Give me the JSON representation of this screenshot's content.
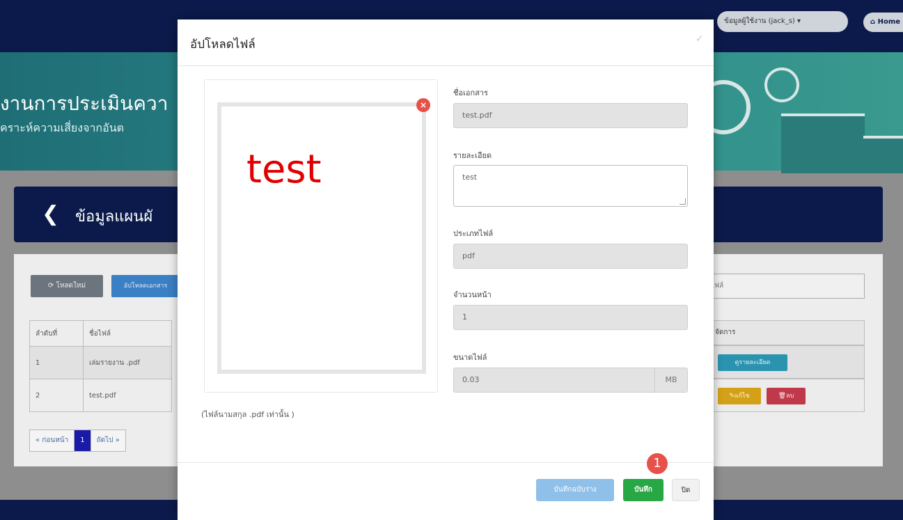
{
  "topbar": {
    "user_label": "ข้อมูลผู้ใช้งาน (jack_s) ▾",
    "home_label": "Home"
  },
  "banner": {
    "title": "งานการประเมินควา",
    "subtitle": "คราะห์ความเสี่ยงจากอันต"
  },
  "section": {
    "title": "ข้อมูลแผนผั"
  },
  "list": {
    "reload_label": "โหลดใหม่",
    "upload_label": "อัปโหลดเอกสาร",
    "search_placeholder": "ไฟล์",
    "headers": [
      "ลำดับที่",
      "ชื่อไฟล์"
    ],
    "manage_header": "จัดการ",
    "rows": [
      {
        "no": "1",
        "name": "เล่มรายงาน .pdf"
      },
      {
        "no": "2",
        "name": "test.pdf"
      }
    ],
    "detail_label": "ดูรายละเอียด",
    "edit_label": "แก้ไข",
    "delete_label": "ลบ"
  },
  "pager": {
    "prev": "« ก่อนหน้า",
    "page": "1",
    "next": "ถัดไป »"
  },
  "modal": {
    "title": "อัปโหลดไฟล์",
    "preview_text": "test",
    "pdf_note": "(ไฟล์นามสกุล .pdf เท่านั้น )",
    "fields": {
      "doc_name_label": "ชื่อเอกสาร",
      "doc_name_value": "test.pdf",
      "detail_label": "รายละเอียด",
      "detail_value": "test",
      "type_label": "ประเภทไฟล์",
      "type_value": "pdf",
      "pages_label": "จำนวนหน้า",
      "pages_value": "1",
      "size_label": "ขนาดไฟล์",
      "size_value": "0.03",
      "size_unit": "MB"
    },
    "buttons": {
      "draft": "บันทึกฉบับร่าง",
      "save": "บันทึก",
      "close": "ปิด"
    },
    "step_badge": "1"
  }
}
